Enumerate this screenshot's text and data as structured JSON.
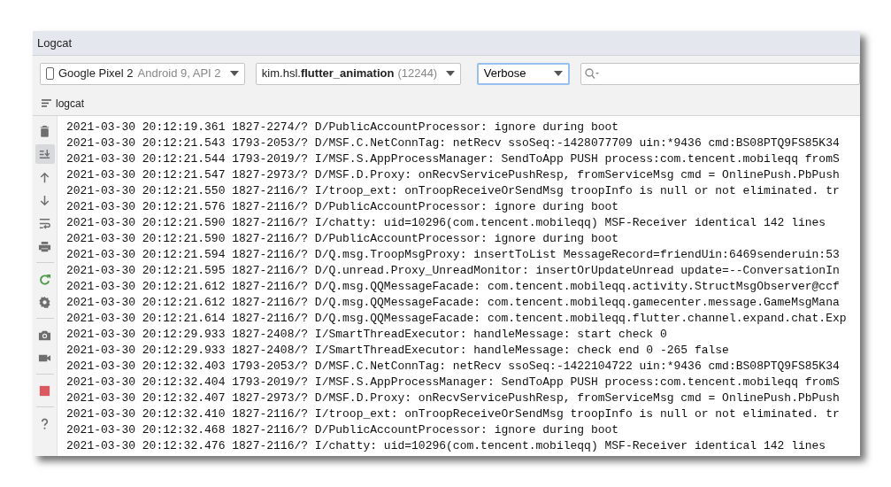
{
  "window": {
    "title": "Logcat"
  },
  "toolbar": {
    "device": {
      "name": "Google Pixel 2",
      "detail": "Android 9, API 2"
    },
    "process": {
      "name": "kim.hsl.**flutter_animation**",
      "pid": "(12244)"
    },
    "log_level": {
      "value": "Verbose",
      "focused": true
    }
  },
  "tab": {
    "label": "logcat"
  },
  "side_tools": [
    {
      "kind": "clear",
      "selected": false
    },
    {
      "kind": "scroll-end",
      "selected": true
    },
    {
      "kind": "up",
      "selected": false
    },
    {
      "kind": "down",
      "selected": false
    },
    {
      "kind": "wrap",
      "selected": false
    },
    {
      "kind": "print",
      "selected": false
    },
    {
      "kind": "separator"
    },
    {
      "kind": "restart",
      "selected": false
    },
    {
      "kind": "settings",
      "selected": false
    },
    {
      "kind": "separator"
    },
    {
      "kind": "screenshot",
      "selected": false
    },
    {
      "kind": "record",
      "selected": false
    },
    {
      "kind": "separator"
    },
    {
      "kind": "stop",
      "selected": false
    },
    {
      "kind": "separator"
    },
    {
      "kind": "help",
      "selected": false
    }
  ],
  "log_lines": [
    "2021-03-30 20:12:19.361 1827-2274/? D/PublicAccountProcessor: ignore during boot",
    "2021-03-30 20:12:21.543 1793-2053/? D/MSF.C.NetConnTag: netRecv ssoSeq:-1428077709 uin:*9436 cmd:BS08PTQ9FS85K34",
    "2021-03-30 20:12:21.544 1793-2019/? I/MSF.S.AppProcessManager: SendToApp PUSH process:com.tencent.mobileqq fromS",
    "2021-03-30 20:12:21.547 1827-2973/? D/MSF.D.Proxy: onRecvServicePushResp, fromServiceMsg cmd = OnlinePush.PbPush",
    "2021-03-30 20:12:21.550 1827-2116/? I/troop_ext: onTroopReceiveOrSendMsg troopInfo is null or not eliminated. tr",
    "2021-03-30 20:12:21.576 1827-2116/? D/PublicAccountProcessor: ignore during boot",
    "2021-03-30 20:12:21.590 1827-2116/? I/chatty: uid=10296(com.tencent.mobileqq) MSF-Receiver identical 142 lines",
    "2021-03-30 20:12:21.590 1827-2116/? D/PublicAccountProcessor: ignore during boot",
    "2021-03-30 20:12:21.594 1827-2116/? D/Q.msg.TroopMsgProxy: insertToList MessageRecord=friendUin:6469senderuin:53",
    "2021-03-30 20:12:21.595 1827-2116/? D/Q.unread.Proxy_UnreadMonitor: insertOrUpdateUnread update=--ConversationIn",
    "2021-03-30 20:12:21.612 1827-2116/? D/Q.msg.QQMessageFacade: com.tencent.mobileqq.activity.StructMsgObserver@ccf",
    "2021-03-30 20:12:21.612 1827-2116/? D/Q.msg.QQMessageFacade: com.tencent.mobileqq.gamecenter.message.GameMsgMana",
    "2021-03-30 20:12:21.614 1827-2116/? D/Q.msg.QQMessageFacade: com.tencent.mobileqq.flutter.channel.expand.chat.Exp",
    "2021-03-30 20:12:29.933 1827-2408/? I/SmartThreadExecutor: handleMessage: start check 0",
    "2021-03-30 20:12:29.933 1827-2408/? I/SmartThreadExecutor: handleMessage: check end 0 -265 false",
    "2021-03-30 20:12:32.403 1793-2053/? D/MSF.C.NetConnTag: netRecv ssoSeq:-1422104722 uin:*9436 cmd:BS08PTQ9FS85K34",
    "2021-03-30 20:12:32.404 1793-2019/? I/MSF.S.AppProcessManager: SendToApp PUSH process:com.tencent.mobileqq fromS",
    "2021-03-30 20:12:32.407 1827-2973/? D/MSF.D.Proxy: onRecvServicePushResp, fromServiceMsg cmd = OnlinePush.PbPush",
    "2021-03-30 20:12:32.410 1827-2116/? I/troop_ext: onTroopReceiveOrSendMsg troopInfo is null or not eliminated. tr",
    "2021-03-30 20:12:32.468 1827-2116/? D/PublicAccountProcessor: ignore during boot",
    "2021-03-30 20:12:32.476 1827-2116/? I/chatty: uid=10296(com.tencent.mobileqq) MSF-Receiver identical 142 lines"
  ]
}
